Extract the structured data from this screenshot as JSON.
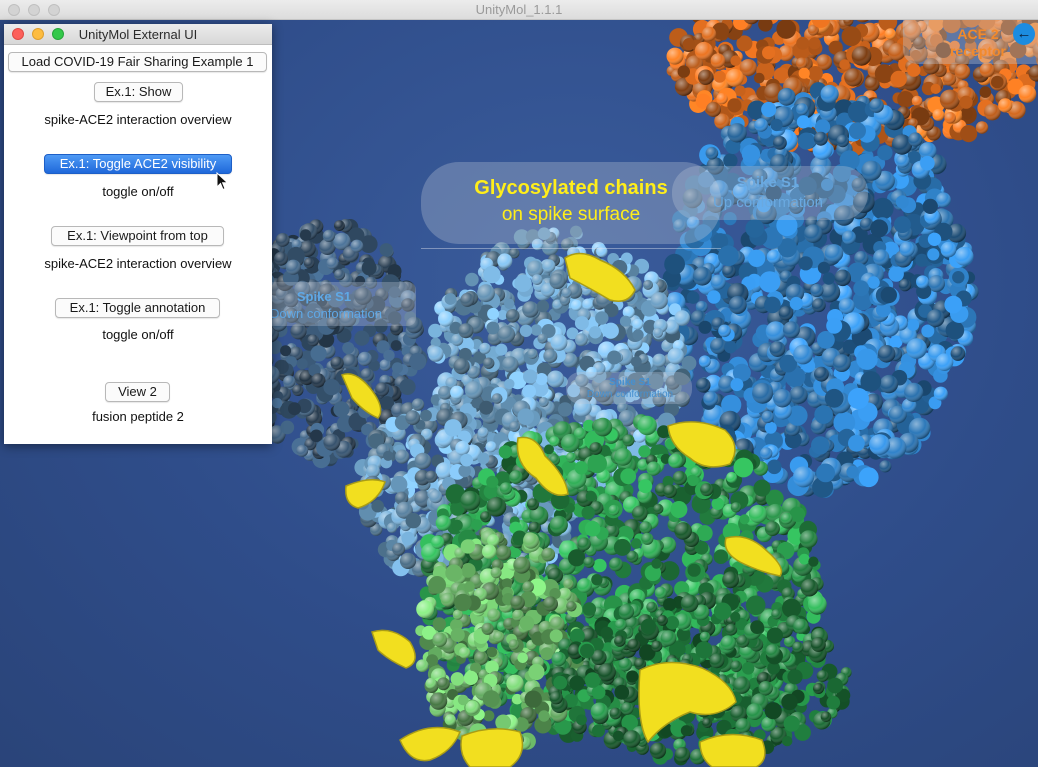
{
  "window": {
    "title": "UnityMol_1.1.1"
  },
  "external_ui": {
    "title": "UnityMol External UI",
    "load_button": "Load COVID-19 Fair Sharing Example 1",
    "show_button": "Ex.1: Show",
    "show_caption": "spike-ACE2 interaction overview",
    "toggle_ace2_button": "Ex.1: Toggle ACE2 visibility",
    "toggle_ace2_caption": "toggle on/off",
    "viewpoint_button": "Ex.1: Viewpoint from top",
    "viewpoint_caption": "spike-ACE2 interaction overview",
    "toggle_annotation_button": "Ex.1: Toggle annotation",
    "toggle_annotation_caption": "toggle on/off",
    "view2_button": "View 2",
    "view2_caption": "fusion peptide 2"
  },
  "scene_labels": {
    "glyco_title": "Glycosylated chains",
    "glyco_subtitle": "on spike surface",
    "spike_up_title": "Spike S1",
    "spike_up_subtitle": "Up conformation",
    "spike_down_left_title": "Spike S1",
    "spike_down_left_subtitle": "Down conformation",
    "spike_down_center_title": "Spike S1",
    "spike_down_center_subtitle": "Down conformation",
    "ace2_title": "ACE 2",
    "ace2_subtitle": "receptor"
  },
  "icons": {
    "ace2_back": "arrow-left-icon",
    "cursor": "mouse-pointer-icon"
  },
  "colors": {
    "background": "#2f4d8a",
    "glyco_label": "#ffee1a",
    "spike_label": "#6aa9e0",
    "ace2_label": "#f28a2c",
    "ace2_atoms": "#d86a1e",
    "spike_up_atoms": "#2f7fc4",
    "spike_down_atoms": "#6fa3c9",
    "spike_green_atoms": "#2a9a4c",
    "glycans": "#f2df1f",
    "selected_button": "#1f68da"
  }
}
